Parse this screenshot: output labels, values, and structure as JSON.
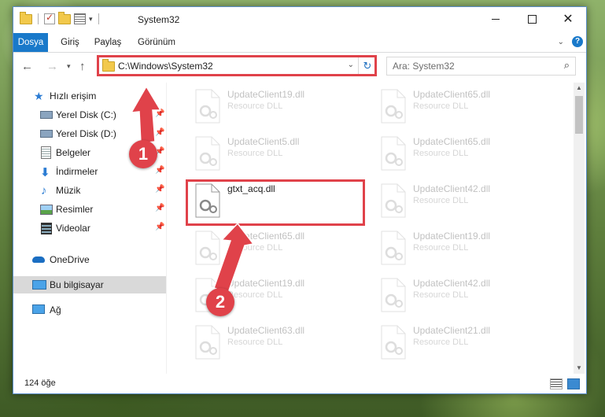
{
  "window": {
    "title": "System32",
    "controls": {
      "minimize": "—",
      "maximize": "☐",
      "close": "✕"
    }
  },
  "ribbon": {
    "tabs": [
      {
        "label": "Dosya",
        "active": true
      },
      {
        "label": "Giriş"
      },
      {
        "label": "Paylaş"
      },
      {
        "label": "Görünüm"
      }
    ],
    "help": "?"
  },
  "address_bar": {
    "path": "C:\\Windows\\System32",
    "search_placeholder": "Ara: System32"
  },
  "nav_pane": {
    "items": [
      {
        "label": "Hızlı erişim",
        "icon": "star-icon"
      },
      {
        "label": "Yerel Disk (C:)",
        "icon": "drive-icon",
        "pinned": true
      },
      {
        "label": "Yerel Disk (D:)",
        "icon": "drive-icon",
        "pinned": true
      },
      {
        "label": "Belgeler",
        "icon": "documents-icon",
        "pinned": true
      },
      {
        "label": "İndirmeler",
        "icon": "download-icon",
        "pinned": true
      },
      {
        "label": "Müzik",
        "icon": "music-icon",
        "pinned": true
      },
      {
        "label": "Resimler",
        "icon": "pictures-icon",
        "pinned": true
      },
      {
        "label": "Videolar",
        "icon": "videos-icon",
        "pinned": true
      },
      {
        "label": "OneDrive",
        "icon": "cloud-icon"
      },
      {
        "label": "Bu bilgisayar",
        "icon": "computer-icon",
        "selected": true
      },
      {
        "label": "Ağ",
        "icon": "network-icon"
      }
    ]
  },
  "files": [
    {
      "name": "UpdateClient19.dll",
      "type": "Resource DLL",
      "faded": true
    },
    {
      "name": "UpdateClient65.dll",
      "type": "Resource DLL",
      "faded": true
    },
    {
      "name": "UpdateClient5.dll",
      "type": "Resource DLL",
      "faded": true
    },
    {
      "name": "UpdateClient65.dll",
      "type": "Resource DLL",
      "faded": true
    },
    {
      "name": "gtxt_acq.dll",
      "type": "",
      "faded": false,
      "highlighted": true
    },
    {
      "name": "UpdateClient42.dll",
      "type": "Resource DLL",
      "faded": true
    },
    {
      "name": "UpdateClient65.dll",
      "type": "Resource DLL",
      "faded": true
    },
    {
      "name": "UpdateClient19.dll",
      "type": "Resource DLL",
      "faded": true
    },
    {
      "name": "UpdateClient19.dll",
      "type": "Resource DLL",
      "faded": true
    },
    {
      "name": "UpdateClient42.dll",
      "type": "Resource DLL",
      "faded": true
    },
    {
      "name": "UpdateClient63.dll",
      "type": "Resource DLL",
      "faded": true
    },
    {
      "name": "UpdateClient21.dll",
      "type": "Resource DLL",
      "faded": true
    }
  ],
  "status_bar": {
    "item_count": "124 öğe"
  },
  "annotations": {
    "step1": "1",
    "step2": "2",
    "highlight_color": "#e0424a"
  },
  "colors": {
    "accent": "#1979ca",
    "folder": "#f2c94c"
  }
}
